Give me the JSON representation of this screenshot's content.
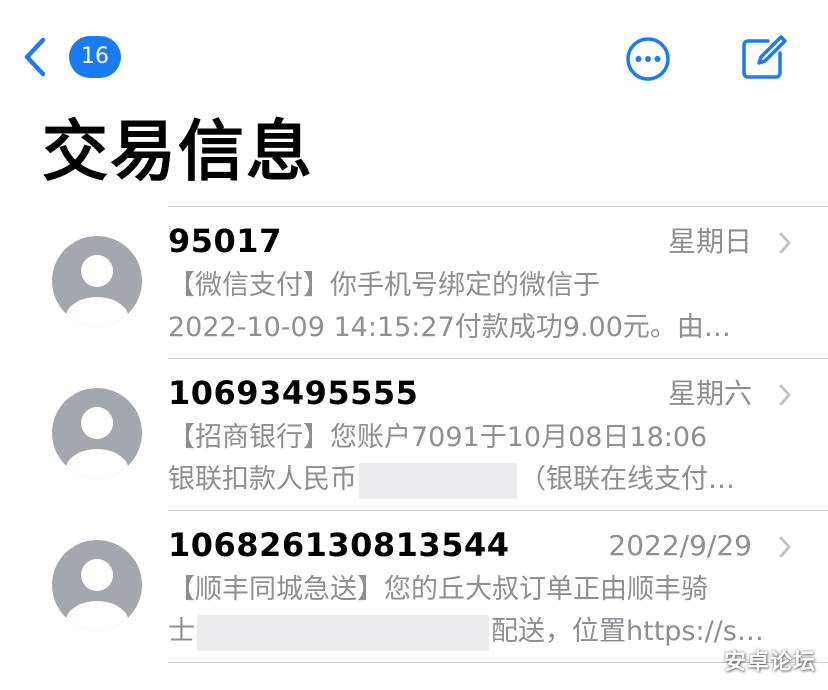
{
  "nav": {
    "unread_count": "16",
    "back_icon": "chevron-left-icon",
    "more_icon": "ellipsis-circle-icon",
    "compose_icon": "compose-icon"
  },
  "title": "交易信息",
  "colors": {
    "accent": "#1a7cf5",
    "secondary_text": "#8e8e93",
    "avatar": "#a5a7ae"
  },
  "messages": [
    {
      "sender": "95017",
      "date": "星期日",
      "preview_line1": "【微信支付】你手机号绑定的微信于",
      "preview_line2": "2022-10-09 14:15:27付款成功9.00元。由…"
    },
    {
      "sender": "10693495555",
      "date": "星期六",
      "preview_line1": "【招商银行】您账户7091于10月08日18:06",
      "preview_line2a": "银联扣款人民币",
      "preview_line2b": "（银联在线支付…"
    },
    {
      "sender": "106826130813544",
      "date": "2022/9/29",
      "preview_line1": "【顺丰同城急送】您的丘大叔订单正由顺丰骑",
      "preview_line2a": "士",
      "preview_line2b": "配送，位置https://s…"
    }
  ],
  "watermark": "安卓论坛"
}
